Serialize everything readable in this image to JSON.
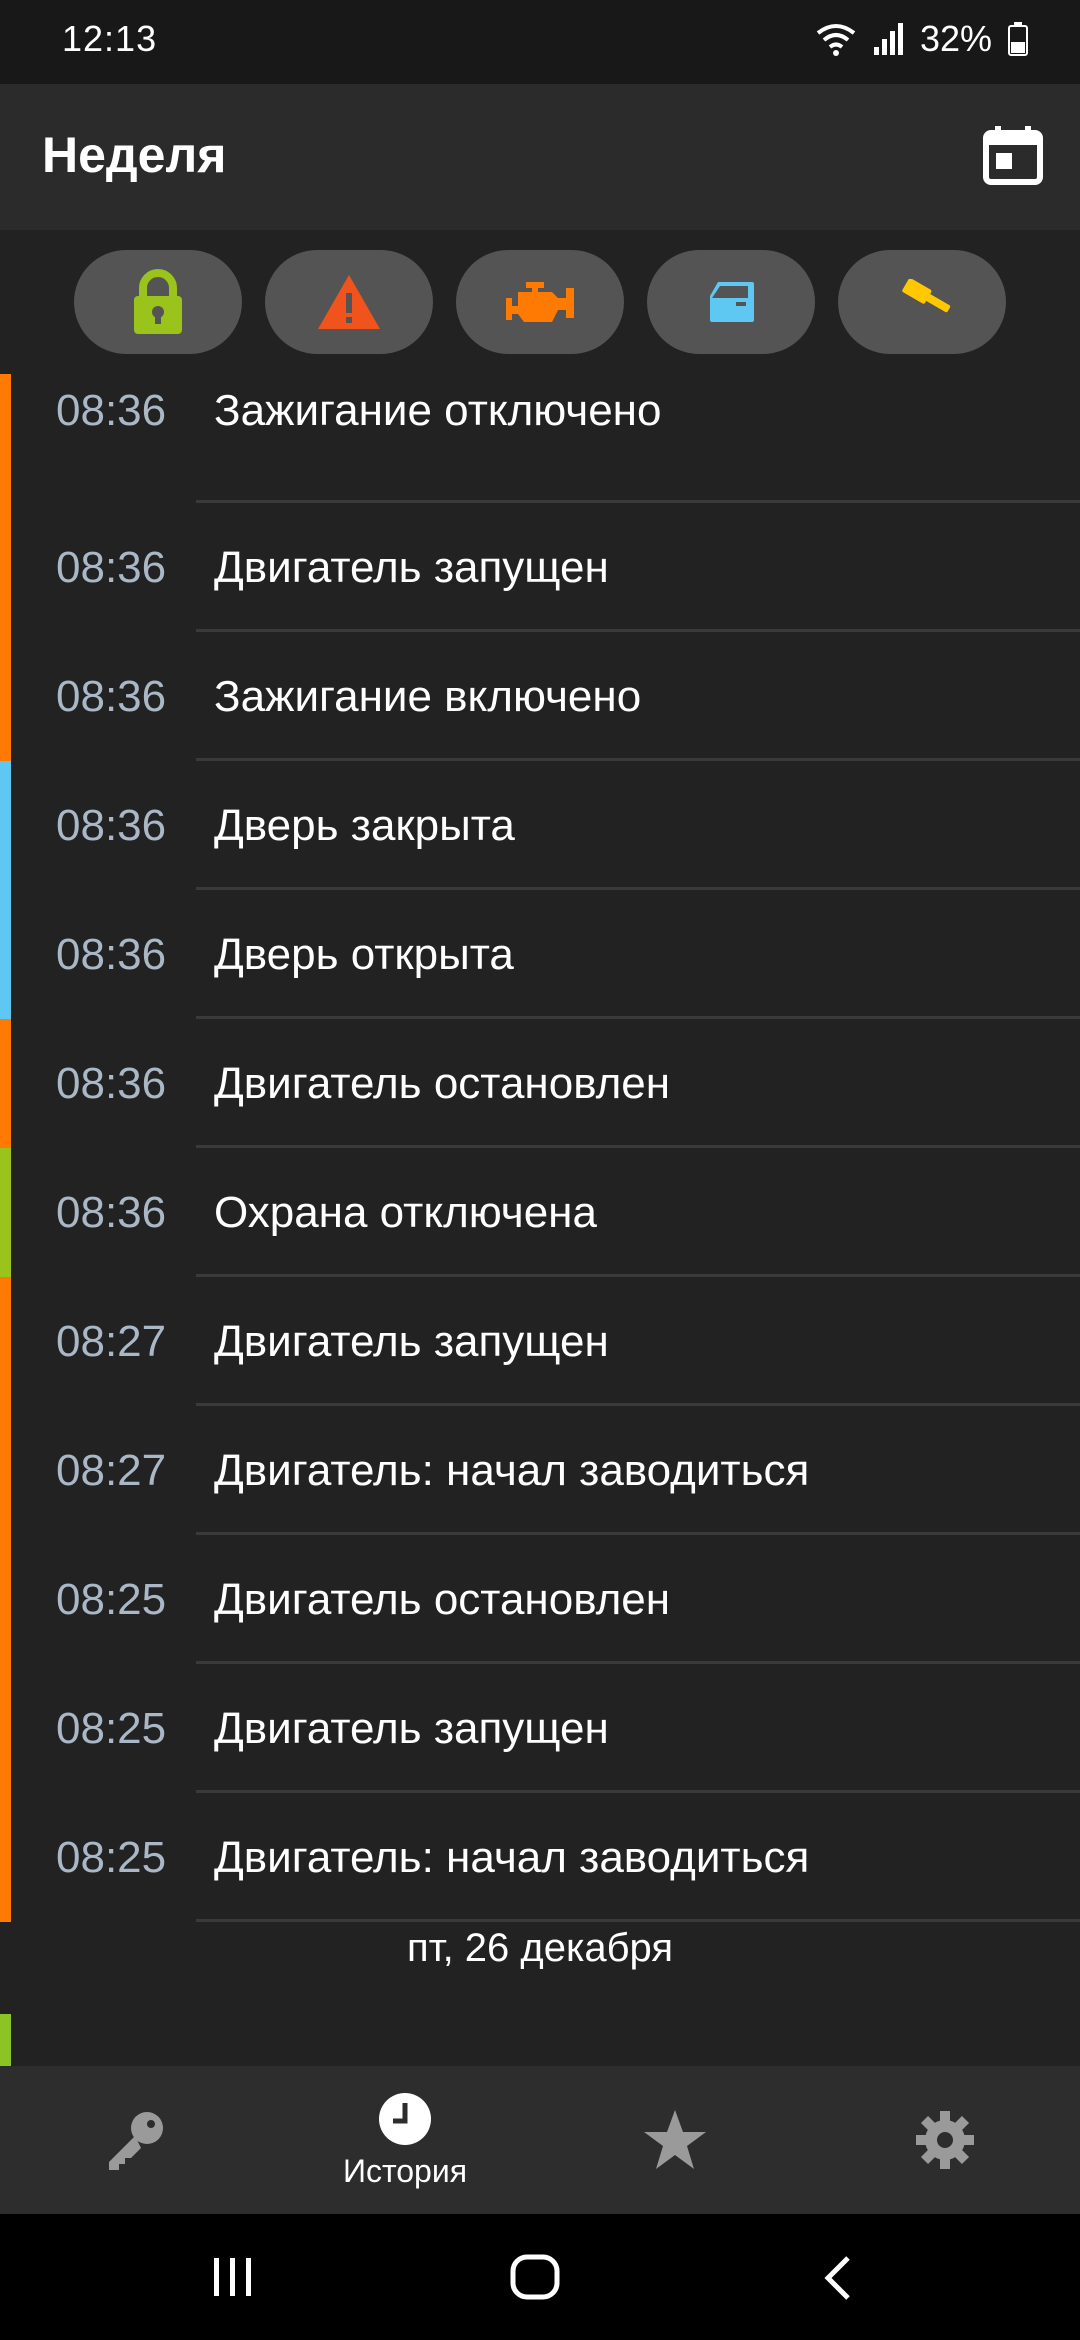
{
  "status_bar": {
    "time": "12:13",
    "battery": "32%"
  },
  "app_bar": {
    "title": "Неделя"
  },
  "filters": [
    {
      "icon": "lock-icon",
      "color": "#9ac31c"
    },
    {
      "icon": "warning-icon",
      "color": "#f0531c"
    },
    {
      "icon": "engine-icon",
      "color": "#ff7a00"
    },
    {
      "icon": "door-icon",
      "color": "#5ec8f2"
    },
    {
      "icon": "hammer-icon",
      "color": "#ffc800"
    }
  ],
  "events": [
    {
      "time": "08:36",
      "text": "Зажигание отключено",
      "color": "#ff7a00"
    },
    {
      "time": "08:36",
      "text": "Двигатель запущен",
      "color": "#ff7a00"
    },
    {
      "time": "08:36",
      "text": "Зажигание включено",
      "color": "#ff7a00"
    },
    {
      "time": "08:36",
      "text": "Дверь закрыта",
      "color": "#5ec8f2"
    },
    {
      "time": "08:36",
      "text": "Дверь открыта",
      "color": "#5ec8f2"
    },
    {
      "time": "08:36",
      "text": "Двигатель остановлен",
      "color": "#ff7a00"
    },
    {
      "time": "08:36",
      "text": "Охрана отключена",
      "color": "#9ac31c"
    },
    {
      "time": "08:27",
      "text": "Двигатель запущен",
      "color": "#ff7a00"
    },
    {
      "time": "08:27",
      "text": "Двигатель: начал заводиться",
      "color": "#ff7a00"
    },
    {
      "time": "08:25",
      "text": "Двигатель остановлен",
      "color": "#ff7a00"
    },
    {
      "time": "08:25",
      "text": "Двигатель запущен",
      "color": "#ff7a00"
    },
    {
      "time": "08:25",
      "text": "Двигатель: начал заводиться",
      "color": "#ff7a00"
    }
  ],
  "date_header": "пт, 26 декабря",
  "bottom_nav": {
    "items": [
      {
        "icon": "key-icon",
        "label": ""
      },
      {
        "icon": "clock-icon",
        "label": "История"
      },
      {
        "icon": "star-icon",
        "label": ""
      },
      {
        "icon": "gear-icon",
        "label": ""
      }
    ]
  },
  "system_nav": {
    "icons": [
      "recents-icon",
      "home-icon",
      "back-icon"
    ]
  }
}
